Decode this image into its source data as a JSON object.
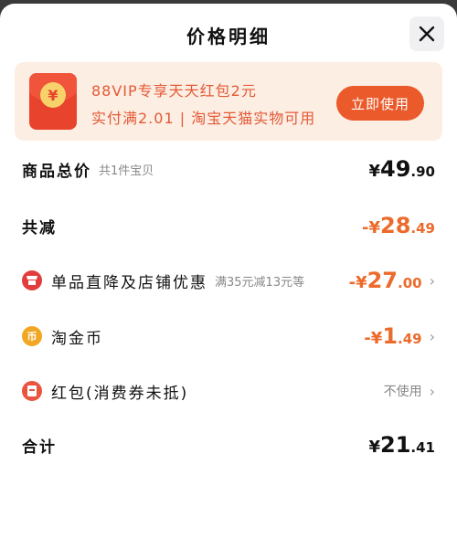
{
  "header": {
    "title": "价格明细",
    "close_icon": "close-icon"
  },
  "banner": {
    "icon": "red-packet-icon",
    "icon_glyph": "¥",
    "line1": "88VIP专享天天红包2元",
    "line2": "实付满2.01 | 淘宝天猫实物可用",
    "button": "立即使用"
  },
  "rows": {
    "total_price": {
      "label": "商品总价",
      "sub": "共1件宝贝",
      "sign": "¥",
      "int": "49",
      "dec": ".90"
    },
    "total_discount": {
      "label": "共减",
      "sign": "-¥",
      "int": "28",
      "dec": ".49"
    },
    "store_discount": {
      "icon": "shop-icon",
      "label": "单品直降及店铺优惠",
      "sub": "满35元减13元等",
      "sign": "-¥",
      "int": "27",
      "dec": ".00"
    },
    "taojinbi": {
      "icon": "coin-icon",
      "icon_glyph": "币",
      "label": "淘金币",
      "sign": "-¥",
      "int": "1",
      "dec": ".49"
    },
    "red_packet": {
      "icon": "red-packet-icon",
      "label": "红包(消费券未抵)",
      "value": "不使用"
    },
    "subtotal": {
      "label": "合计",
      "sign": "¥",
      "int": "21",
      "dec": ".41"
    }
  },
  "colors": {
    "accent_orange": "#ec6a2b",
    "banner_bg": "#fdeee4",
    "button_bg": "#ea5a2a"
  }
}
